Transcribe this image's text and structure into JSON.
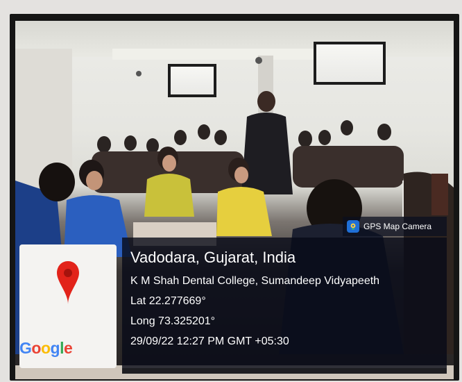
{
  "photo": {
    "description_icons": [
      "map-pin-icon",
      "gps-map-camera-logo-icon"
    ]
  },
  "brand": {
    "name": "GPS Map Camera"
  },
  "map": {
    "provider_logo": "Google",
    "pin_color": "#e2231a"
  },
  "location": {
    "city": "Vadodara, Gujarat, India",
    "address": "K M Shah Dental College, Sumandeep Vidyapeeth",
    "lat": "Lat 22.277669°",
    "long": "Long 73.325201°",
    "datetime": "29/09/22 12:27 PM GMT +05:30"
  },
  "colors": {
    "overlay_bg": "#0a0e1e",
    "text": "#ffffff",
    "google_blue": "#4285f4",
    "google_red": "#ea4335",
    "google_yellow": "#fbbc05",
    "google_green": "#34a853"
  }
}
